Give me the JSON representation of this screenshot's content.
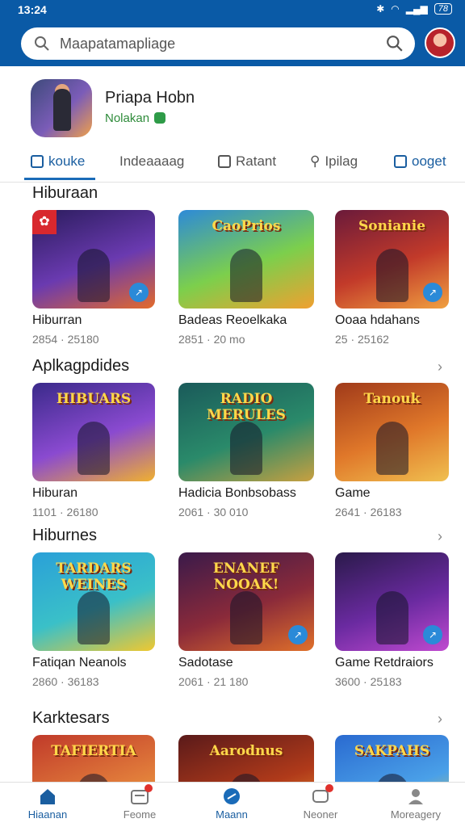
{
  "status_bar": {
    "time": "13:24",
    "battery": "78"
  },
  "search": {
    "placeholder": "Maapatamapliage"
  },
  "profile": {
    "name": "Priapa Hobn",
    "subtitle": "Nolakan"
  },
  "tabs": [
    {
      "label": "kouke",
      "active": true
    },
    {
      "label": "Indeaaaag",
      "active": false
    },
    {
      "label": "Ratant",
      "active": false
    },
    {
      "label": "Ipilag",
      "active": false
    },
    {
      "label": "ooget",
      "active": false
    }
  ],
  "sections": [
    {
      "title": "Hiburaan",
      "apps": [
        {
          "name": "Hiburran",
          "meta": "2854 · 25180",
          "art_title": "",
          "colors": [
            "#2a1c5c",
            "#6a3ab0",
            "#e36a2a"
          ]
        },
        {
          "name": "Badeas Reoelkaka",
          "meta": "2851 · 20 mo",
          "art_title": "CaoPrios",
          "colors": [
            "#2d8ad8",
            "#7ccf4c",
            "#f0a030"
          ]
        },
        {
          "name": "Ooaa hdahans",
          "meta": "25 · 25162",
          "art_title": "Sonianie",
          "colors": [
            "#6a1a3a",
            "#c23a2a",
            "#f0a040"
          ]
        }
      ]
    },
    {
      "title": "Aplkagpdides",
      "apps": [
        {
          "name": "Hiburan",
          "meta": "1101 · 26180",
          "art_title": "HIBUARS",
          "colors": [
            "#3a2a8a",
            "#8a4ad0",
            "#f0b030"
          ]
        },
        {
          "name": "Hadicia Bonbsobass",
          "meta": "2061 · 30 010",
          "art_title": "RADIO MERULES",
          "colors": [
            "#1a5a5a",
            "#2a8a6a",
            "#c8a040"
          ]
        },
        {
          "name": "Game",
          "meta": "2641 · 26183",
          "art_title": "Tanouk",
          "colors": [
            "#a03a1a",
            "#e0782a",
            "#f0c050"
          ]
        }
      ]
    },
    {
      "title": "Hiburnes",
      "apps": [
        {
          "name": "Fatiqan Neanols",
          "meta": "2860 · 36183",
          "art_title": "TARDARS WEINES",
          "colors": [
            "#2aa0d8",
            "#3ac0c8",
            "#f0c830"
          ]
        },
        {
          "name": "Sadotase",
          "meta": "2061 · 21 180",
          "art_title": "ENANEF NOOAK!",
          "colors": [
            "#3a1a4a",
            "#8a2a3a",
            "#e0702a"
          ]
        },
        {
          "name": "Game Retdraiors",
          "meta": "3600 · 25183",
          "art_title": "",
          "colors": [
            "#2a1a4a",
            "#6a2aa0",
            "#c04ad0"
          ]
        }
      ]
    },
    {
      "title": "Karktesars",
      "apps": [
        {
          "name": "",
          "meta": "",
          "art_title": "TAFIERTIA",
          "colors": [
            "#c03a2a",
            "#e07a3a",
            "#f0b040"
          ]
        },
        {
          "name": "",
          "meta": "",
          "art_title": "Aarodnus",
          "colors": [
            "#5a1a1a",
            "#b03a1a",
            "#f0a030"
          ]
        },
        {
          "name": "",
          "meta": "",
          "art_title": "SAKPAHS",
          "colors": [
            "#2a6ad0",
            "#4aa0e8",
            "#f0d040"
          ]
        }
      ]
    }
  ],
  "bottom_nav": [
    {
      "label": "Hiaanan",
      "active": true
    },
    {
      "label": "Feome",
      "active": false
    },
    {
      "label": "Maann",
      "active": false
    },
    {
      "label": "Neoner",
      "active": false
    },
    {
      "label": "Moreagery",
      "active": false
    }
  ],
  "colors": {
    "primary": "#0a5aa6",
    "accent": "#1a6bb8",
    "green": "#2e8b3a"
  }
}
